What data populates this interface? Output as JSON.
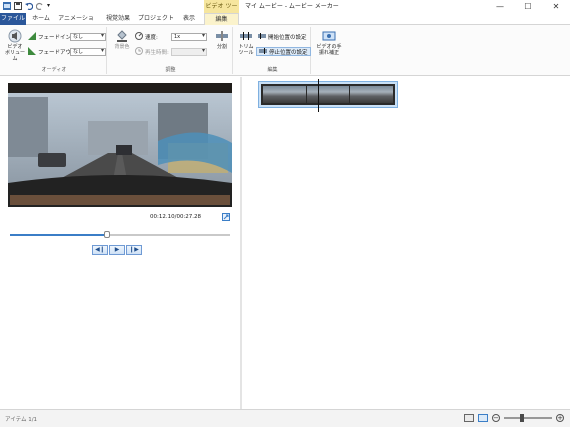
{
  "window": {
    "title": "マイ ムービー - ムービー メーカー",
    "context_tab_group": "ビデオ ツール",
    "controls": [
      "—",
      "☐",
      "✕"
    ]
  },
  "tabs": [
    {
      "label": "ファイル"
    },
    {
      "label": "ホーム"
    },
    {
      "label": "アニメーション"
    },
    {
      "label": "視覚効果"
    },
    {
      "label": "プロジェクト"
    },
    {
      "label": "表示"
    },
    {
      "label": "編集"
    }
  ],
  "ribbon": {
    "audio": {
      "group_label": "オーディオ",
      "video_volume": "ビデオ\nボリューム",
      "fade_in_label": "フェードイン:",
      "fade_in_value": "なし",
      "fade_out_label": "フェードアウト:",
      "fade_out_value": "なし"
    },
    "adjust": {
      "group_label": "調整",
      "bg_color_label": "背景色",
      "speed_label": "速度:",
      "speed_value": "1x",
      "duration_label": "再生時間:",
      "duration_value": "",
      "split_label": "分割"
    },
    "edit": {
      "group_label": "編集",
      "trim_tool_label": "トリム\nツール",
      "set_start_label": "開始位置の設定",
      "set_end_label": "停止位置の設定"
    },
    "stabilize": {
      "label": "ビデオの手\n振れ補正"
    }
  },
  "preview": {
    "timecode": "00:12.10/00:27.28",
    "progress_fraction": 0.44
  },
  "status": {
    "items_text": "アイテム 1/1"
  },
  "zoom": {
    "minus": "−",
    "plus": "+"
  }
}
